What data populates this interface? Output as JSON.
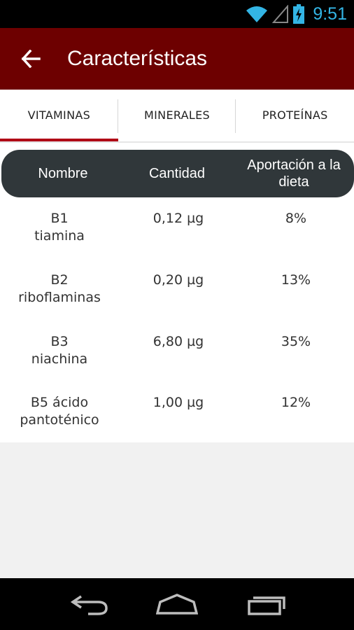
{
  "status_bar": {
    "time": "9:51"
  },
  "app_bar": {
    "title": "Características"
  },
  "tabs": [
    {
      "label": "VITAMINAS",
      "selected": true
    },
    {
      "label": "MINERALES",
      "selected": false
    },
    {
      "label": "PROTEÍNAS",
      "selected": false
    }
  ],
  "table": {
    "headers": {
      "name": "Nombre",
      "quantity": "Cantidad",
      "contribution": "Aportación a la dieta"
    },
    "rows": [
      {
        "name_line1": "B1",
        "name_line2": "tiamina",
        "quantity": "0,12 µg",
        "contribution": "8%"
      },
      {
        "name_line1": "B2",
        "name_line2": "riboflaminas",
        "quantity": "0,20 µg",
        "contribution": "13%"
      },
      {
        "name_line1": "B3",
        "name_line2": "niachina",
        "quantity": "6,80 µg",
        "contribution": "35%"
      },
      {
        "name_line1": "B5 ácido",
        "name_line2": "pantoténico",
        "quantity": "1,00 µg",
        "contribution": "12%"
      }
    ]
  },
  "colors": {
    "app_bar": "#6d0000",
    "tab_indicator": "#b00015",
    "header_bg": "#30373a",
    "status_accent": "#33b5e5"
  },
  "icons": [
    "wifi-icon",
    "signal-icon",
    "battery-charging-icon",
    "back-arrow-icon",
    "nav-back-icon",
    "nav-home-icon",
    "nav-recents-icon"
  ]
}
